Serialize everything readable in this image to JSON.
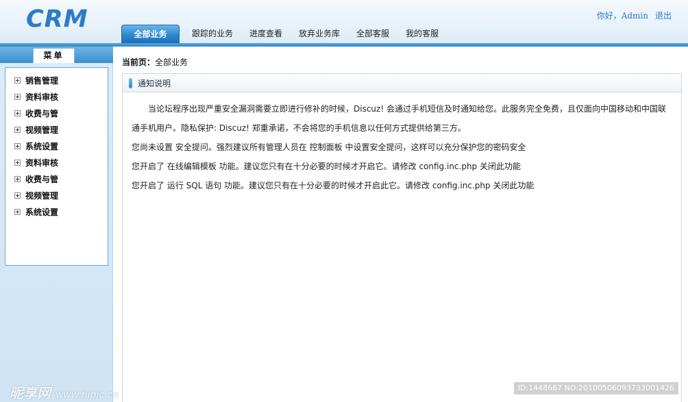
{
  "header": {
    "logo": "CRM",
    "greeting": "你好，Admin",
    "logout": "退出",
    "nav": [
      {
        "label": "全部业务",
        "active": true
      },
      {
        "label": "跟踪的业务"
      },
      {
        "label": "进度查看"
      },
      {
        "label": "放弃业务库"
      },
      {
        "label": "全部客服"
      },
      {
        "label": "我的客服"
      }
    ]
  },
  "sidebar": {
    "tab": "菜单",
    "items": [
      {
        "label": "销售管理"
      },
      {
        "label": "资料审核"
      },
      {
        "label": "收费与管"
      },
      {
        "label": "视频管理"
      },
      {
        "label": "系统设置"
      },
      {
        "label": "资料审核"
      },
      {
        "label": "收费与管"
      },
      {
        "label": "视频管理"
      },
      {
        "label": "系统设置"
      }
    ]
  },
  "main": {
    "breadcrumb_label": "当前页：",
    "breadcrumb_value": "全部业务",
    "panel_title": "通知说明",
    "paragraphs": [
      "当论坛程序出现严重安全漏洞需要立即进行修补的时候，Discuz! 会通过手机短信及时通知给您。此服务完全免费，且仅面向中国移动和中国联通手机用户。隐私保护: Discuz! 郑重承诺，不会将您的手机信息以任何方式提供给第三方。",
      "您尚未设置 安全提问。强烈建议所有管理人员在 控制面板 中设置安全提问，这样可以充分保护您的密码安全",
      "您开启了 在线编辑模板 功能。建议您只有在十分必要的时候才开启它。请修改 config.inc.php 关闭此功能",
      "您开启了 运行 SQL 语句 功能。建议您只有在十分必要的时候才开启此它。请修改 config.inc.php 关闭此功能"
    ]
  },
  "watermark": {
    "site": "昵享网",
    "url": "www.nipic.cn",
    "id": "ID:1448667 NO:20100506093733001426"
  }
}
